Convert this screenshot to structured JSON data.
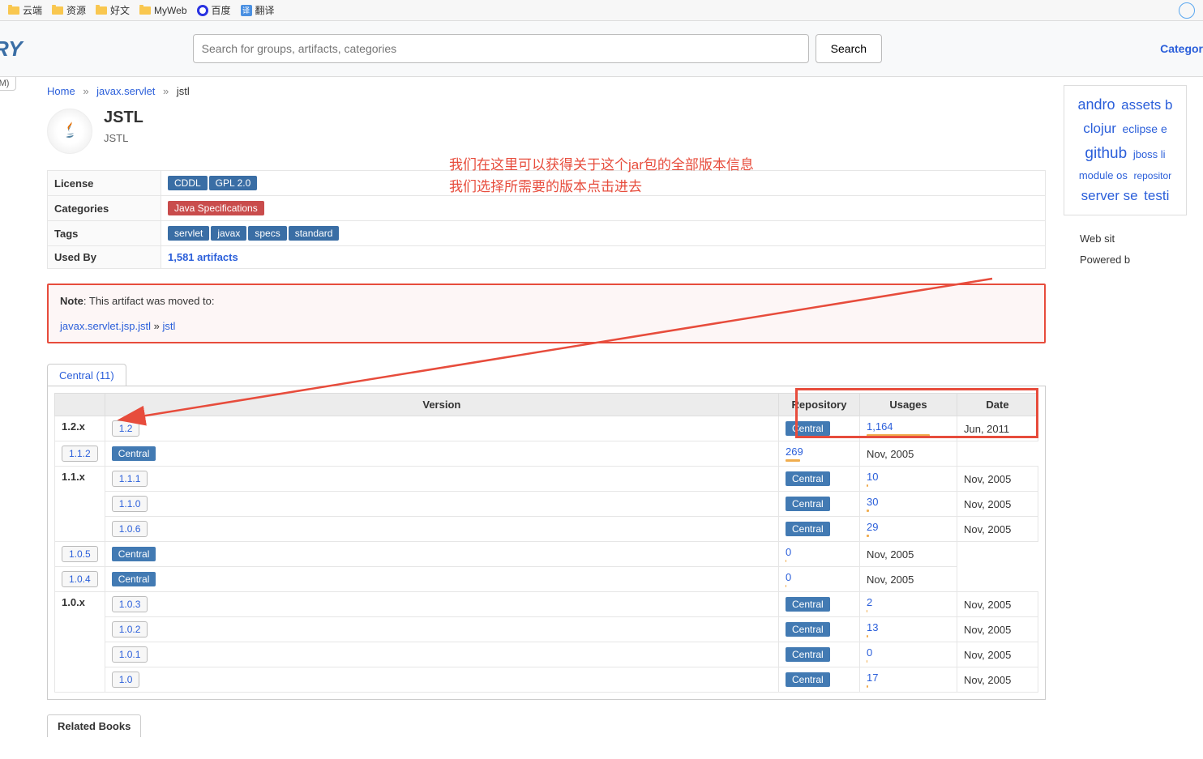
{
  "bookmarks": [
    {
      "label": "云端",
      "icon": "folder"
    },
    {
      "label": "资源",
      "icon": "folder"
    },
    {
      "label": "好文",
      "icon": "folder"
    },
    {
      "label": "MyWeb",
      "icon": "folder"
    },
    {
      "label": "百度",
      "icon": "baidu"
    },
    {
      "label": "翻译",
      "icon": "trans"
    }
  ],
  "search": {
    "placeholder": "Search for groups, artifacts, categories",
    "button": "Search"
  },
  "nav": {
    "category": "Categor"
  },
  "breadcrumb": {
    "home": "Home",
    "group": "javax.servlet",
    "artifact": "jstl"
  },
  "artifact": {
    "title": "JSTL",
    "desc": "JSTL"
  },
  "meta": {
    "license_label": "License",
    "licenses": [
      "CDDL",
      "GPL 2.0"
    ],
    "categories_label": "Categories",
    "categories": [
      "Java Specifications"
    ],
    "tags_label": "Tags",
    "tags": [
      "servlet",
      "javax",
      "specs",
      "standard"
    ],
    "usedby_label": "Used By",
    "usedby": "1,581 artifacts"
  },
  "note": {
    "label": "Note",
    "text": "This artifact was moved to:",
    "group": "javax.servlet.jsp.jstl",
    "artifact": "jstl"
  },
  "annotation": {
    "line1": "我们在这里可以获得关于这个jar包的全部版本信息",
    "line2": "我们选择所需要的版本点击进去"
  },
  "tabs": {
    "central": "Central (11)"
  },
  "table": {
    "headers": [
      "",
      "Version",
      "Repository",
      "Usages",
      "Date"
    ],
    "rows": [
      {
        "group": "1.2.x",
        "version": "1.2",
        "repo": "Central",
        "usages": "1,164",
        "bar": 78,
        "date": "Jun, 2011"
      },
      {
        "group": "",
        "version": "1.1.2",
        "repo": "Central",
        "usages": "269",
        "bar": 18,
        "date": "Nov, 2005"
      },
      {
        "group": "1.1.x",
        "version": "1.1.1",
        "repo": "Central",
        "usages": "10",
        "bar": 2,
        "date": "Nov, 2005"
      },
      {
        "group": "",
        "version": "1.1.0",
        "repo": "Central",
        "usages": "30",
        "bar": 3,
        "date": "Nov, 2005"
      },
      {
        "group": "",
        "version": "1.0.6",
        "repo": "Central",
        "usages": "29",
        "bar": 3,
        "date": "Nov, 2005"
      },
      {
        "group": "",
        "version": "1.0.5",
        "repo": "Central",
        "usages": "0",
        "bar": 1,
        "date": "Nov, 2005"
      },
      {
        "group": "",
        "version": "1.0.4",
        "repo": "Central",
        "usages": "0",
        "bar": 1,
        "date": "Nov, 2005"
      },
      {
        "group": "1.0.x",
        "version": "1.0.3",
        "repo": "Central",
        "usages": "2",
        "bar": 1,
        "date": "Nov, 2005"
      },
      {
        "group": "",
        "version": "1.0.2",
        "repo": "Central",
        "usages": "13",
        "bar": 2,
        "date": "Nov, 2005"
      },
      {
        "group": "",
        "version": "1.0.1",
        "repo": "Central",
        "usages": "0",
        "bar": 1,
        "date": "Nov, 2005"
      },
      {
        "group": "",
        "version": "1.0",
        "repo": "Central",
        "usages": "17",
        "bar": 2,
        "date": "Nov, 2005"
      }
    ]
  },
  "related": "Related Books",
  "tag_cloud": [
    {
      "t": "andro",
      "s": 18
    },
    {
      "t": "assets b",
      "s": 17
    },
    {
      "t": "clojur",
      "s": 17
    },
    {
      "t": "eclipse e",
      "s": 14
    },
    {
      "t": "github",
      "s": 19
    },
    {
      "t": "jboss li",
      "s": 13
    },
    {
      "t": "module os",
      "s": 13
    },
    {
      "t": "repositor",
      "s": 12
    },
    {
      "t": "server se",
      "s": 17
    },
    {
      "t": "testi",
      "s": 17
    }
  ],
  "footer": {
    "line1": "Web sit",
    "line2": "Powered b"
  }
}
